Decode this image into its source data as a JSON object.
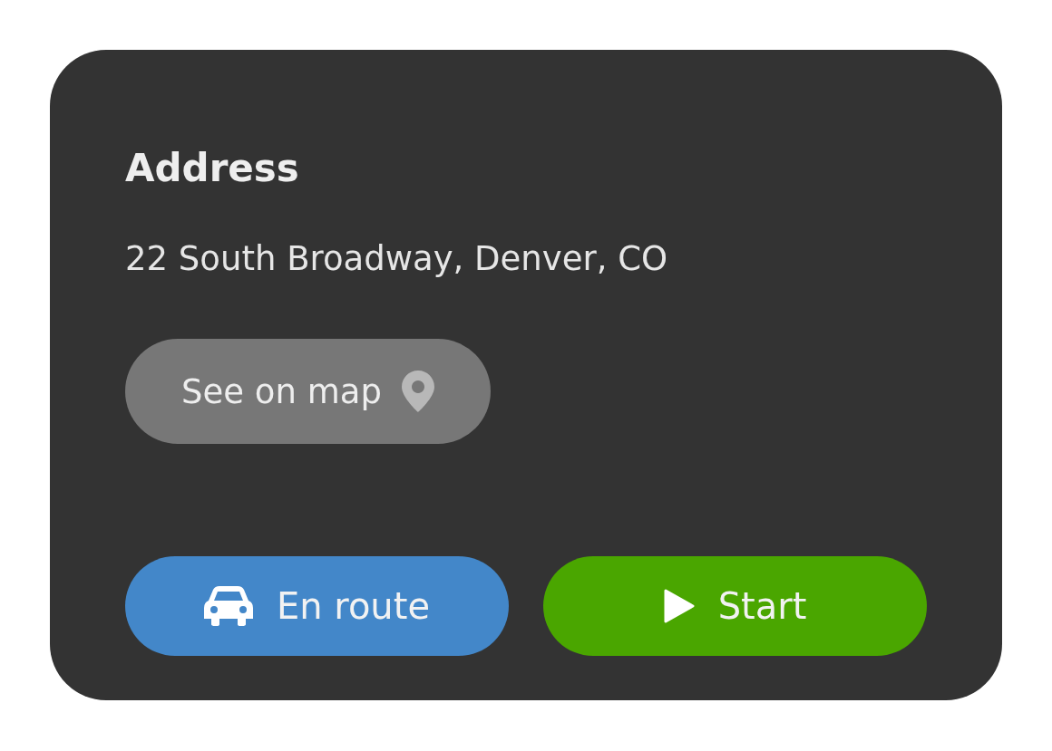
{
  "card": {
    "title": "Address",
    "address": "22 South Broadway, Denver, CO",
    "map_button": {
      "label": "See on map"
    },
    "actions": [
      {
        "kind": "en_route",
        "label": "En route",
        "color": "#4387c9"
      },
      {
        "kind": "start",
        "label": "Start",
        "color": "#4aa600"
      }
    ]
  }
}
